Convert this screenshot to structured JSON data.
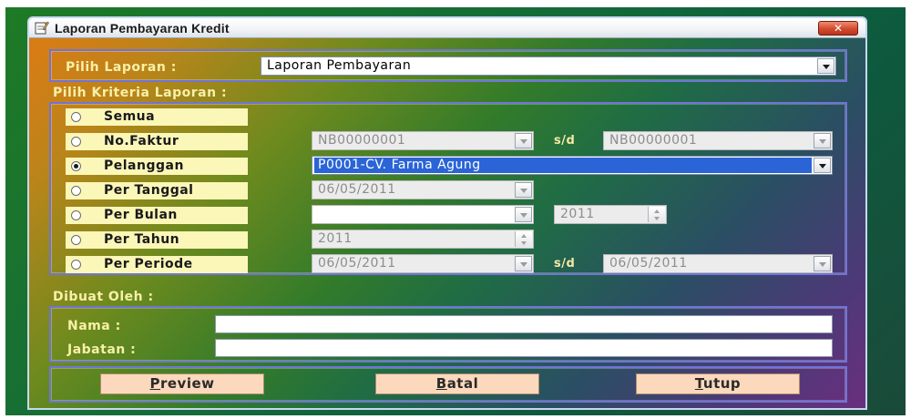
{
  "window": {
    "title": "Laporan Pembayaran Kredit",
    "close_label": "✕"
  },
  "pilih_laporan": {
    "label": "Pilih Laporan :",
    "value": "Laporan Pembayaran"
  },
  "kriteria": {
    "label": "Pilih Kriteria Laporan :",
    "options": [
      {
        "label": "Semua",
        "selected": false
      },
      {
        "label": "No.Faktur",
        "selected": false
      },
      {
        "label": "Pelanggan",
        "selected": true
      },
      {
        "label": "Per Tanggal",
        "selected": false
      },
      {
        "label": "Per Bulan",
        "selected": false
      },
      {
        "label": "Per Tahun",
        "selected": false
      },
      {
        "label": "Per Periode",
        "selected": false
      }
    ],
    "faktur_from": "NB00000001",
    "faktur_to": "NB00000001",
    "sd_label": "s/d",
    "pelanggan_value": "P0001-CV. Farma Agung",
    "tanggal_value": "06/05/2011",
    "bulan_value": "",
    "bulan_year": "2011",
    "tahun_value": "2011",
    "periode_from": "06/05/2011",
    "periode_to": "06/05/2011"
  },
  "dibuat_oleh": {
    "label": "Dibuat Oleh :",
    "nama_label": "Nama :",
    "nama_value": "",
    "jabatan_label": "Jabatan :",
    "jabatan_value": ""
  },
  "buttons": {
    "preview_key": "P",
    "preview_rest": "review",
    "batal_key": "B",
    "batal_rest": "atal",
    "tutup_key": "T",
    "tutup_rest": "utup"
  },
  "colors": {
    "selection": "#2a64d6",
    "option_bg": "#fbf7b8",
    "button_bg": "#fcd9bd",
    "group_border": "#6f74d6"
  }
}
